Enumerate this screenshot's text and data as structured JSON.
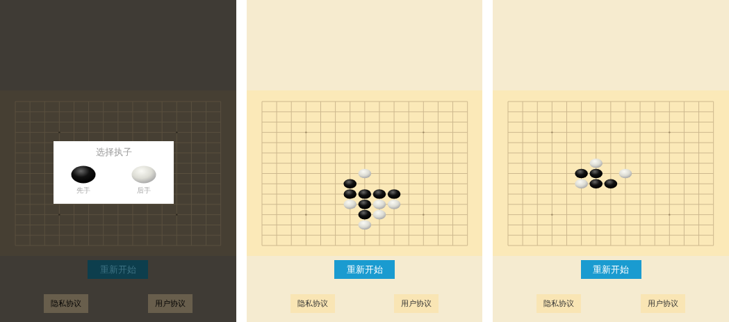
{
  "screens": [
    {
      "dimmed": true,
      "dialog": {
        "title": "选择执子",
        "options": [
          {
            "kind": "black",
            "label": "先手"
          },
          {
            "kind": "white",
            "label": "后手"
          }
        ]
      },
      "restart_button": "重新开始",
      "links": [
        "隐私协议",
        "用户协议"
      ]
    },
    {
      "dimmed": false,
      "board": [
        [
          {
            "kind": "empty"
          }
        ],
        [
          {
            "kind": "empty"
          }
        ],
        [
          {
            "kind": "empty"
          }
        ],
        [
          {
            "kind": "empty"
          }
        ],
        [
          {
            "kind": "empty"
          }
        ],
        [
          {
            "kind": "empty"
          }
        ],
        [
          {
            "kind": "empty"
          }
        ],
        [
          {
            "kind": "empty"
          },
          {
            "kind": "empty"
          },
          {
            "kind": "empty"
          },
          {
            "kind": "empty"
          },
          {
            "kind": "empty"
          },
          {
            "kind": "empty"
          },
          {
            "kind": "empty"
          },
          {
            "kind": "white"
          }
        ],
        [
          {
            "kind": "empty"
          },
          {
            "kind": "empty"
          },
          {
            "kind": "empty"
          },
          {
            "kind": "empty"
          },
          {
            "kind": "empty"
          },
          {
            "kind": "empty"
          },
          {
            "kind": "black"
          }
        ],
        [
          {
            "kind": "empty"
          },
          {
            "kind": "empty"
          },
          {
            "kind": "empty"
          },
          {
            "kind": "empty"
          },
          {
            "kind": "empty"
          },
          {
            "kind": "empty"
          },
          {
            "kind": "black"
          },
          {
            "kind": "black"
          },
          {
            "kind": "black"
          },
          {
            "kind": "black"
          }
        ],
        [
          {
            "kind": "empty"
          },
          {
            "kind": "empty"
          },
          {
            "kind": "empty"
          },
          {
            "kind": "empty"
          },
          {
            "kind": "empty"
          },
          {
            "kind": "empty"
          },
          {
            "kind": "white"
          },
          {
            "kind": "black"
          },
          {
            "kind": "white"
          },
          {
            "kind": "white"
          }
        ],
        [
          {
            "kind": "empty"
          },
          {
            "kind": "empty"
          },
          {
            "kind": "empty"
          },
          {
            "kind": "empty"
          },
          {
            "kind": "empty"
          },
          {
            "kind": "empty"
          },
          {
            "kind": "empty"
          },
          {
            "kind": "black"
          },
          {
            "kind": "white"
          }
        ],
        [
          {
            "kind": "empty"
          },
          {
            "kind": "empty"
          },
          {
            "kind": "empty"
          },
          {
            "kind": "empty"
          },
          {
            "kind": "empty"
          },
          {
            "kind": "empty"
          },
          {
            "kind": "empty"
          },
          {
            "kind": "white"
          }
        ]
      ],
      "restart_button": "重新开始",
      "links": [
        "隐私协议",
        "用户协议"
      ]
    },
    {
      "dimmed": false,
      "board": [
        [
          {
            "kind": "empty"
          }
        ],
        [
          {
            "kind": "empty"
          }
        ],
        [
          {
            "kind": "empty"
          }
        ],
        [
          {
            "kind": "empty"
          }
        ],
        [
          {
            "kind": "empty"
          }
        ],
        [
          {
            "kind": "empty"
          }
        ],
        [
          {
            "kind": "empty"
          },
          {
            "kind": "empty"
          },
          {
            "kind": "empty"
          },
          {
            "kind": "empty"
          },
          {
            "kind": "empty"
          },
          {
            "kind": "empty"
          },
          {
            "kind": "white"
          }
        ],
        [
          {
            "kind": "empty"
          },
          {
            "kind": "empty"
          },
          {
            "kind": "empty"
          },
          {
            "kind": "empty"
          },
          {
            "kind": "empty"
          },
          {
            "kind": "black"
          },
          {
            "kind": "black"
          },
          {
            "kind": "empty"
          },
          {
            "kind": "white"
          }
        ],
        [
          {
            "kind": "empty"
          },
          {
            "kind": "empty"
          },
          {
            "kind": "empty"
          },
          {
            "kind": "empty"
          },
          {
            "kind": "empty"
          },
          {
            "kind": "white"
          },
          {
            "kind": "black"
          },
          {
            "kind": "black"
          }
        ]
      ],
      "restart_button": "重新开始",
      "links": [
        "隐私协议",
        "用户协议"
      ]
    }
  ]
}
